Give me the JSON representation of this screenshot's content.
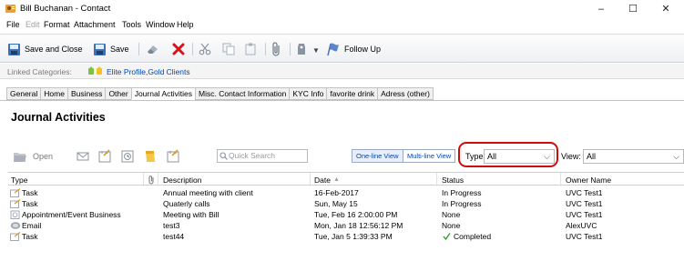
{
  "window": {
    "title": "Bill Buchanan - Contact",
    "controls": {
      "minimize": "–",
      "maximize": "☐",
      "close": "✕"
    }
  },
  "menu": {
    "items": [
      "File",
      "Edit",
      "Format",
      "Attachment",
      "Tools",
      "Window",
      "Help"
    ],
    "disabled": [
      "Edit"
    ]
  },
  "toolbar": {
    "save_close": "Save and Close",
    "save": "Save",
    "follow_up": "Follow Up"
  },
  "linked": {
    "label": "Linked Categories:",
    "categories": "Elite Profile,Gold Clients"
  },
  "tabs": [
    {
      "label": "General"
    },
    {
      "label": "Home"
    },
    {
      "label": "Business"
    },
    {
      "label": "Other"
    },
    {
      "label": "Journal Activities",
      "active": true
    },
    {
      "label": "Misc. Contact Information"
    },
    {
      "label": "KYC Info"
    },
    {
      "label": "favorite drink"
    },
    {
      "label": "Adress (other)"
    }
  ],
  "journal": {
    "title": "Journal Activities",
    "open_label": "Open",
    "search_placeholder": "Quick Search",
    "one_line_view": "One-line View",
    "multi_line_view": "Multi-line View",
    "type_label": "Type:",
    "type_value": "All",
    "view_label": "View:",
    "view_value": "All"
  },
  "table": {
    "columns": [
      "Type",
      "Description",
      "Date",
      "Status",
      "Owner Name"
    ],
    "sort_indicator": "▲",
    "rows": [
      {
        "type": "Task",
        "icon": "task-icon",
        "description": "Annual meeting with client",
        "date": "16-Feb-2017",
        "status": "In Progress",
        "owner": "UVC Test1"
      },
      {
        "type": "Task",
        "icon": "task-icon",
        "description": "Quaterly calls",
        "date": "Sun, May 15",
        "status": "In Progress",
        "owner": "UVC Test1"
      },
      {
        "type": "Appointment/Event Business",
        "icon": "appointment-icon",
        "description": "Meeting with Bill",
        "date": "Tue, Feb 16 2:00:00 PM",
        "status": "None",
        "owner": "UVC Test1"
      },
      {
        "type": "Email",
        "icon": "email-icon",
        "description": "test3",
        "date": "Mon, Jan 18 12:56:12 PM",
        "status": "None",
        "owner": "AlexUVC"
      },
      {
        "type": "Task",
        "icon": "task-icon",
        "description": "test44",
        "date": "Tue, Jan 5 1:39:33 PM",
        "status": "Completed",
        "owner": "UVC Test1",
        "completed": true
      }
    ]
  },
  "colors": {
    "highlight_ring": "#d20a0a",
    "link_blue": "#0047b3",
    "completed_green": "#2c9a2c"
  }
}
